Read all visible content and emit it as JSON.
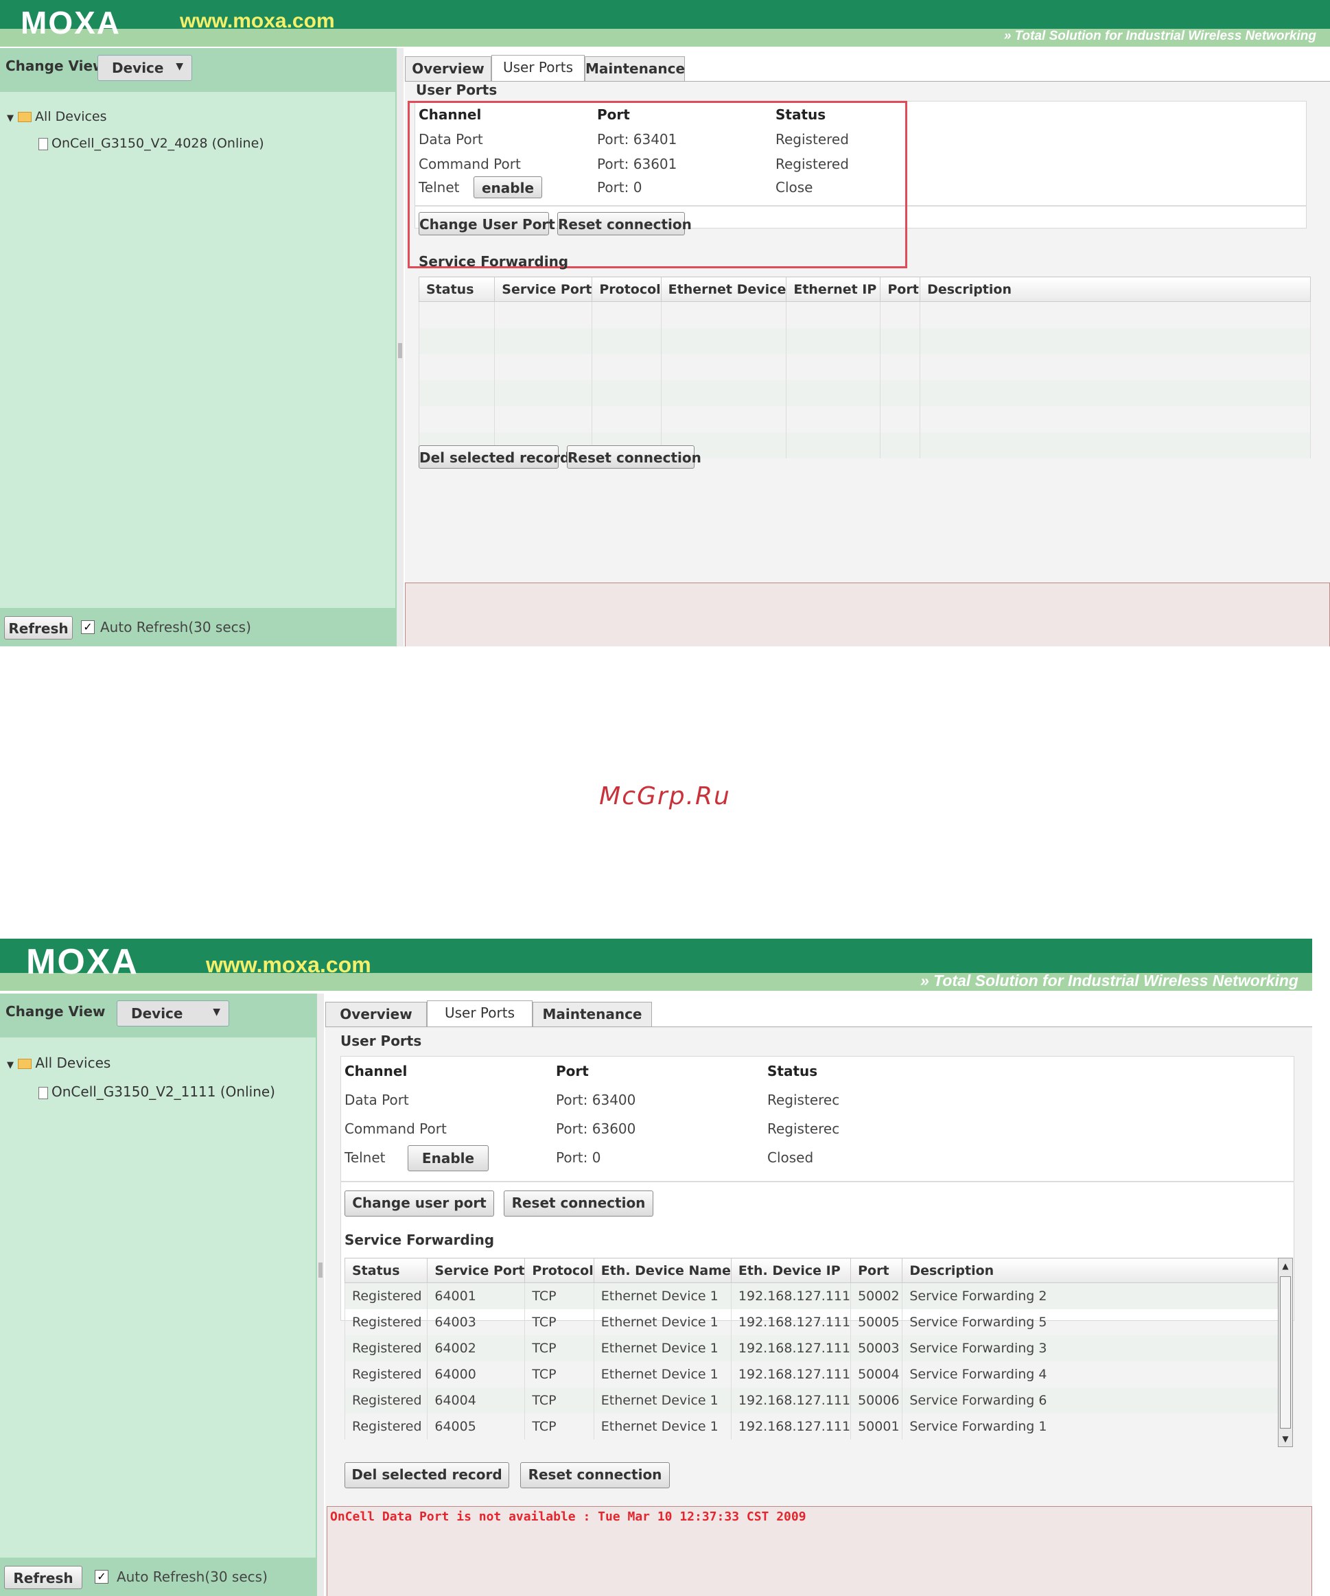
{
  "brand": {
    "logo": "MOXA",
    "site": "www.moxa.com",
    "slogan": "» Total Solution for Industrial Wireless Networking"
  },
  "watermark": "McGrp.Ru",
  "sidebar": {
    "change_view_label": "Change View",
    "view_select": "Device",
    "tree_root": "All Devices",
    "refresh_label": "Refresh",
    "auto_refresh_label": "Auto Refresh(30 secs)",
    "auto_refresh_checked": true
  },
  "screens": [
    {
      "device_name": "OnCell_G3150_V2_4028 (Online)",
      "tabs": [
        "Overview",
        "User Ports",
        "Maintenance"
      ],
      "active_tab": "User Ports",
      "user_ports": {
        "title": "User Ports",
        "headers": [
          "Channel",
          "Port",
          "Status"
        ],
        "rows": [
          {
            "channel": "Data Port",
            "port": "Port: 63401",
            "status": "Registered"
          },
          {
            "channel": "Command Port",
            "port": "Port: 63601",
            "status": "Registered"
          },
          {
            "channel": "Telnet",
            "port": "Port: 0",
            "status": "Close"
          }
        ],
        "telnet_button": "enable",
        "change_button": "Change User Port",
        "reset_button": "Reset connection"
      },
      "service_forwarding": {
        "title": "Service Forwarding",
        "headers": [
          "Status",
          "Service Port",
          "Protocol",
          "Ethernet Device",
          "Ethernet IP",
          "Port",
          "Description"
        ],
        "rows": [],
        "delete_button": "Del selected record",
        "reset_button": "Reset connection"
      },
      "message": ""
    },
    {
      "device_name": "OnCell_G3150_V2_1111 (Online)",
      "tabs": [
        "Overview",
        "User Ports",
        "Maintenance"
      ],
      "active_tab": "User Ports",
      "user_ports": {
        "title": "User Ports",
        "headers": [
          "Channel",
          "Port",
          "Status"
        ],
        "rows": [
          {
            "channel": "Data Port",
            "port": "Port: 63400",
            "status": "Registerec"
          },
          {
            "channel": "Command Port",
            "port": "Port: 63600",
            "status": "Registerec"
          },
          {
            "channel": "Telnet",
            "port": "Port: 0",
            "status": "Closed"
          }
        ],
        "telnet_button": "Enable",
        "change_button": "Change user port",
        "reset_button": "Reset connection"
      },
      "service_forwarding": {
        "title": "Service Forwarding",
        "headers": [
          "Status",
          "Service Port",
          "Protocol",
          "Eth. Device Name",
          "Eth. Device IP",
          "Port",
          "Description"
        ],
        "rows": [
          [
            "Registered",
            "64001",
            "TCP",
            "Ethernet Device 1",
            "192.168.127.111",
            "50002",
            "Service Forwarding 2"
          ],
          [
            "Registered",
            "64003",
            "TCP",
            "Ethernet Device 1",
            "192.168.127.111",
            "50005",
            "Service Forwarding 5"
          ],
          [
            "Registered",
            "64002",
            "TCP",
            "Ethernet Device 1",
            "192.168.127.111",
            "50003",
            "Service Forwarding 3"
          ],
          [
            "Registered",
            "64000",
            "TCP",
            "Ethernet Device 1",
            "192.168.127.111",
            "50004",
            "Service Forwarding 4"
          ],
          [
            "Registered",
            "64004",
            "TCP",
            "Ethernet Device 1",
            "192.168.127.111",
            "50006",
            "Service Forwarding 6"
          ],
          [
            "Registered",
            "64005",
            "TCP",
            "Ethernet Device 1",
            "192.168.127.111",
            "50001",
            "Service Forwarding 1"
          ]
        ],
        "delete_button": "Del selected record",
        "reset_button": "Reset connection"
      },
      "message": "OnCell Data Port is not available : Tue Mar 10 12:37:33 CST 2009"
    }
  ],
  "colors": {
    "header_green": "#1d8a5c",
    "sidebar_green": "#cdecd8",
    "highlight_red": "#e14b57",
    "message_red": "#e3262d"
  }
}
